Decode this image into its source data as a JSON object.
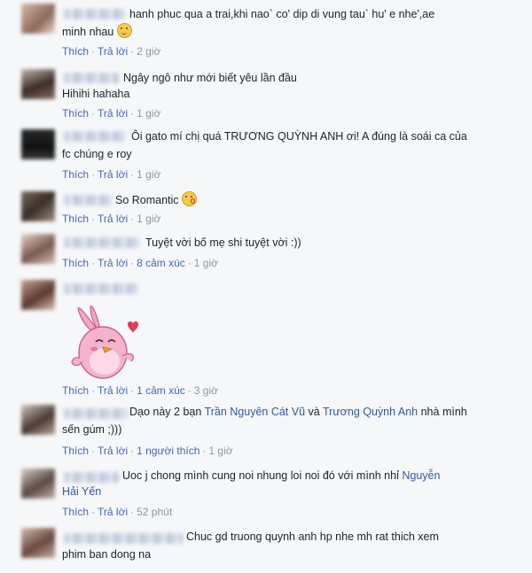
{
  "comments": [
    {
      "text": "hanh phuc qua a trai,khi nao` co' dip di vung tau` hu' e nhe',ae",
      "text2": "minh nhau",
      "actions": {
        "like": "Thích",
        "reply": "Trả lời",
        "time": "2 giờ"
      }
    },
    {
      "text": "Ngây ngô như mới biết yêu lần đầu",
      "text2": "Hihihi hahaha",
      "actions": {
        "like": "Thích",
        "reply": "Trả lời",
        "time": "1 giờ"
      }
    },
    {
      "text": "Ôi gato mí chị quá TRƯƠNG QUỲNH ANH ơi! A đúng là soái ca của",
      "text2": "fc chúng e roy",
      "actions": {
        "like": "Thích",
        "reply": "Trả lời",
        "time": "1 giờ"
      }
    },
    {
      "text": "So Romantic",
      "actions": {
        "like": "Thích",
        "reply": "Trả lời",
        "time": "1 giờ"
      }
    },
    {
      "text": "Tuyệt vời bố mẹ shi tuyệt vời :))",
      "actions": {
        "like": "Thích",
        "reply": "Trả lời",
        "reactions": "8 cảm xúc",
        "time": "1 giờ"
      }
    },
    {
      "actions": {
        "like": "Thích",
        "reply": "Trả lời",
        "reactions": "1 cảm xúc",
        "time": "3 giờ"
      }
    },
    {
      "text_a": "Dạo này 2 bạn",
      "link1": "Trần Nguyên Cát Vũ",
      "text_b": "và",
      "link2": "Trương Quỳnh Anh",
      "text_c": "nhà mình",
      "text2": "sến gúm ;)))",
      "actions": {
        "like": "Thích",
        "reply": "Trả lời",
        "likes": "1 người thích",
        "time": "1 giờ"
      }
    },
    {
      "text_a": "Uoc j chong mình cung noi nhung loi noi đó với mình nhỉ",
      "link1": "Nguyễn",
      "link1b": "Hải Yến",
      "actions": {
        "like": "Thích",
        "reply": "Trả lời",
        "time": "52 phút"
      }
    },
    {
      "text": "Chuc gd truong quynh anh hp nhe mh rat thich xem",
      "text2": "phim ban dong na"
    }
  ],
  "emoji_smile": "smile-emoji",
  "emoji_kiss": "kiss-emoji"
}
